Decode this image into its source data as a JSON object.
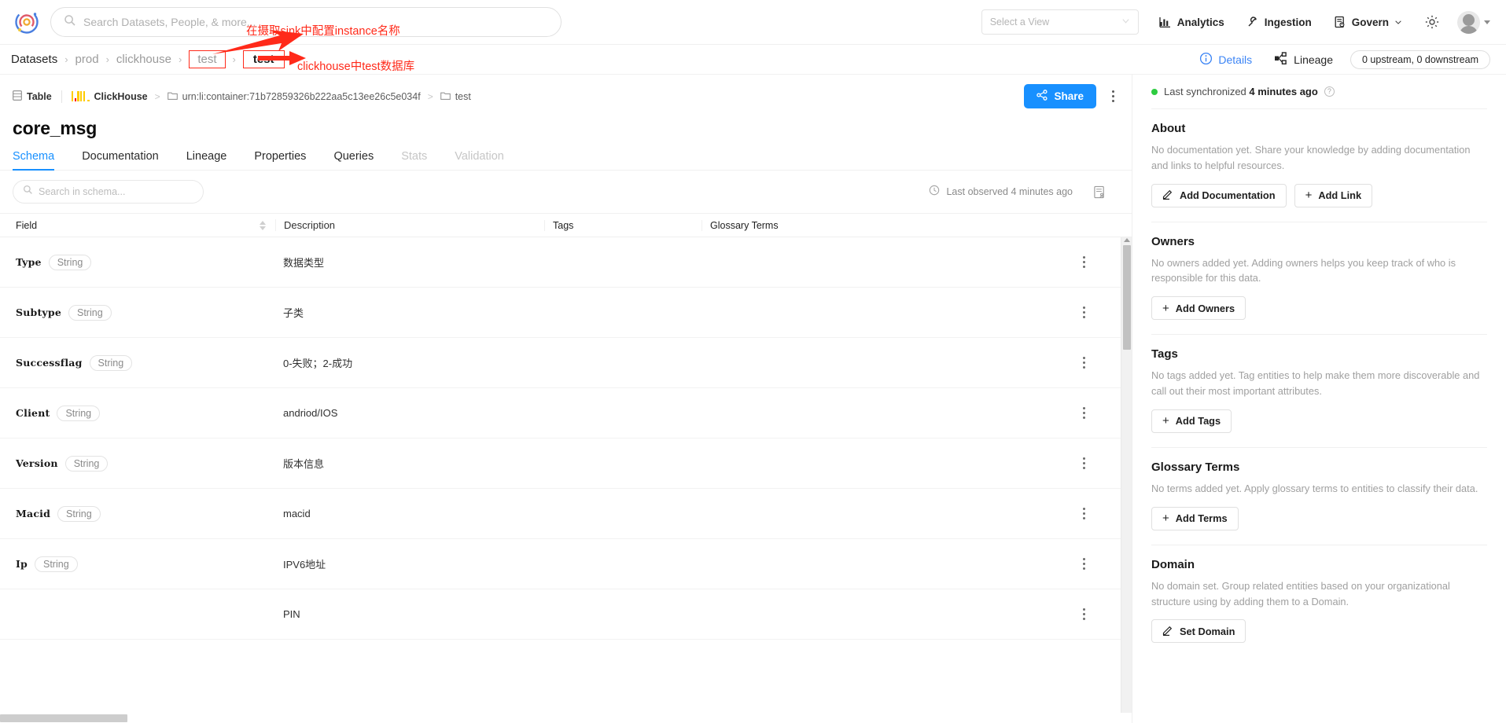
{
  "topnav": {
    "logo_icon": "datahub-logo-icon",
    "search": {
      "placeholder": "Search Datasets, People, & more...",
      "value": "",
      "icon": "search-icon"
    },
    "view_select": {
      "placeholder": "Select a View",
      "value": "Select a View",
      "icon": "chevron-down-icon"
    },
    "links": [
      {
        "label": "Analytics",
        "icon": "bar-chart-icon"
      },
      {
        "label": "Ingestion",
        "icon": "plug-icon"
      },
      {
        "label": "Govern",
        "icon": "governance-icon",
        "caret": "chevron-down-icon"
      }
    ],
    "settings_icon": "gear-icon",
    "avatar_icon": "avatar-icon",
    "avatar_caret": "caret-down-icon"
  },
  "breadcrumb": {
    "items": [
      {
        "label": "Datasets",
        "style": "normal"
      },
      {
        "label": "prod",
        "style": "muted"
      },
      {
        "label": "clickhouse",
        "style": "muted"
      },
      {
        "label": "test",
        "style": "boxed1"
      },
      {
        "label": "test",
        "style": "boxed2"
      }
    ],
    "separator": "›",
    "details_label": "Details",
    "details_icon": "info-circle-icon",
    "lineage_label": "Lineage",
    "lineage_icon": "lineage-icon",
    "updown_label": "0 upstream, 0 downstream"
  },
  "annotations": [
    {
      "text": "在摄取sink中配置instance名称",
      "arrow": "red-arrow-up-right"
    },
    {
      "text": "clickhouse中test数据库",
      "arrow": "red-arrow-right"
    }
  ],
  "entity": {
    "type_label": "Table",
    "type_icon": "table-icon",
    "platform": "ClickHouse",
    "platform_icon": "clickhouse-logo-icon",
    "path": [
      {
        "label": "urn:li:container:71b72859326b222aa5c13ee26c5e034f",
        "icon": "folder-icon"
      },
      {
        "label": "test",
        "icon": "folder-icon"
      }
    ],
    "share_label": "Share",
    "share_icon": "share-icon",
    "kebab_icon": "more-vertical-icon",
    "title": "core_msg"
  },
  "tabs": [
    {
      "label": "Schema",
      "state": "active"
    },
    {
      "label": "Documentation",
      "state": "normal"
    },
    {
      "label": "Lineage",
      "state": "normal"
    },
    {
      "label": "Properties",
      "state": "normal"
    },
    {
      "label": "Queries",
      "state": "normal"
    },
    {
      "label": "Stats",
      "state": "disabled"
    },
    {
      "label": "Validation",
      "state": "disabled"
    }
  ],
  "schema": {
    "search_placeholder": "Search in schema...",
    "search_value": "",
    "search_icon": "search-icon",
    "last_observed": "Last observed 4 minutes ago",
    "clock_icon": "clock-icon",
    "raw_schema_icon": "raw-schema-icon",
    "columns": [
      "Field",
      "Description",
      "Tags",
      "Glossary Terms",
      ""
    ],
    "sort_icon": "sort-icon",
    "rows": [
      {
        "field": "Type",
        "type": "String",
        "description": "数据类型",
        "tags": "",
        "glossary": ""
      },
      {
        "field": "Subtype",
        "type": "String",
        "description": "子类",
        "tags": "",
        "glossary": ""
      },
      {
        "field": "Successflag",
        "type": "String",
        "description": "0-失败；2-成功",
        "tags": "",
        "glossary": ""
      },
      {
        "field": "Client",
        "type": "String",
        "description": "andriod/IOS",
        "tags": "",
        "glossary": ""
      },
      {
        "field": "Version",
        "type": "String",
        "description": "版本信息",
        "tags": "",
        "glossary": ""
      },
      {
        "field": "Macid",
        "type": "String",
        "description": "macid",
        "tags": "",
        "glossary": ""
      },
      {
        "field": "Ip",
        "type": "String",
        "description": "IPV6地址",
        "tags": "",
        "glossary": ""
      },
      {
        "field": "",
        "type": "",
        "description": "PIN",
        "tags": "",
        "glossary": ""
      }
    ]
  },
  "sidebar": {
    "sync": {
      "text_prefix": "Last synchronized ",
      "text_strong": "4 minutes ago",
      "help_icon": "question-circle-icon",
      "status_dot_color": "#2ecc40"
    },
    "sections": [
      {
        "title": "About",
        "body": "No documentation yet. Share your knowledge by adding documentation and links to helpful resources.",
        "buttons": [
          {
            "label": "Add Documentation",
            "icon": "pencil-icon"
          },
          {
            "label": "Add Link",
            "icon": "plus-icon"
          }
        ]
      },
      {
        "title": "Owners",
        "body": "No owners added yet. Adding owners helps you keep track of who is responsible for this data.",
        "buttons": [
          {
            "label": "Add Owners",
            "icon": "plus-icon"
          }
        ]
      },
      {
        "title": "Tags",
        "body": "No tags added yet. Tag entities to help make them more discoverable and call out their most important attributes.",
        "buttons": [
          {
            "label": "Add Tags",
            "icon": "plus-icon"
          }
        ]
      },
      {
        "title": "Glossary Terms",
        "body": "No terms added yet. Apply glossary terms to entities to classify their data.",
        "buttons": [
          {
            "label": "Add Terms",
            "icon": "plus-icon"
          }
        ]
      },
      {
        "title": "Domain",
        "body": "No domain set. Group related entities based on your organizational structure using by adding them to a Domain.",
        "buttons": [
          {
            "label": "Set Domain",
            "icon": "pencil-icon"
          }
        ]
      }
    ]
  },
  "colors": {
    "accent": "#1890ff",
    "annotation": "#ff2a1a",
    "status_green": "#2ecc40",
    "muted": "#a0a0a0"
  }
}
